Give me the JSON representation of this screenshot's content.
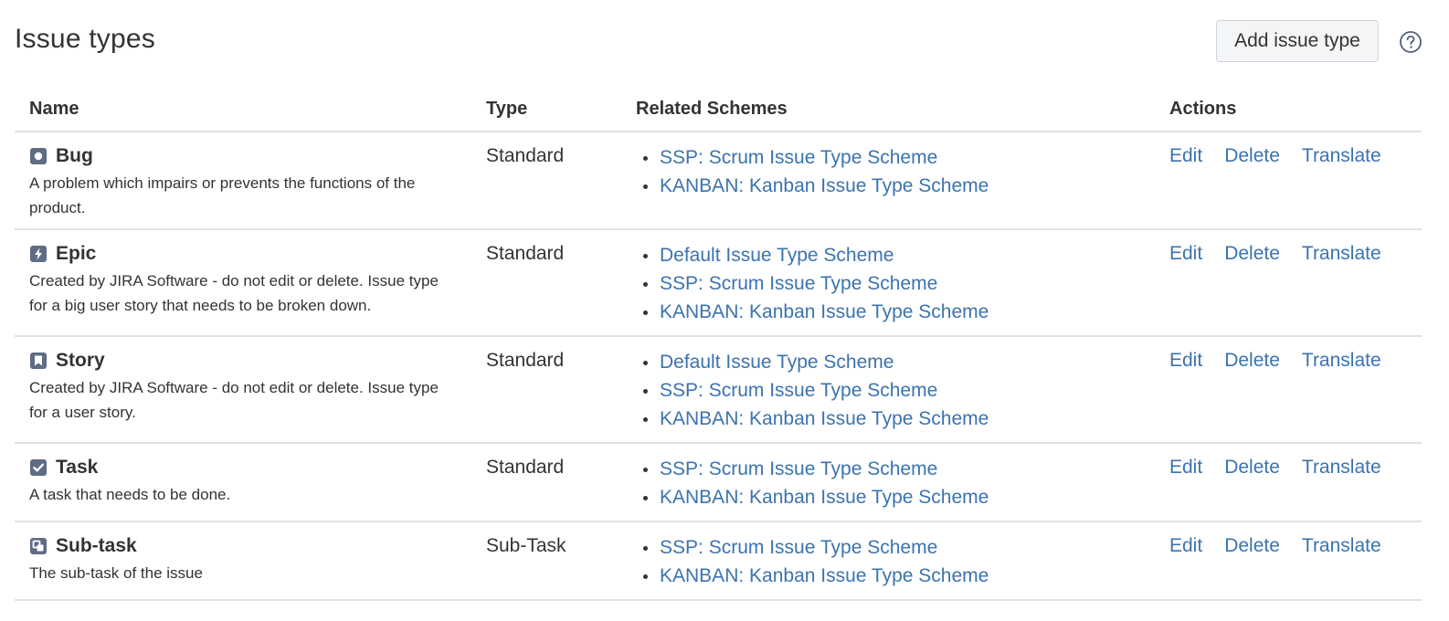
{
  "page": {
    "title": "Issue types",
    "add_button_label": "Add issue type",
    "help_icon": "question-circle-icon"
  },
  "table": {
    "headers": {
      "name": "Name",
      "type": "Type",
      "schemes": "Related Schemes",
      "actions": "Actions"
    },
    "action_labels": {
      "edit": "Edit",
      "delete": "Delete",
      "translate": "Translate"
    },
    "rows": [
      {
        "icon": "bug-icon",
        "icon_color": "#5e6c84",
        "name": "Bug",
        "description": "A problem which impairs or prevents the functions of the product.",
        "type": "Standard",
        "schemes": [
          "SSP: Scrum Issue Type Scheme",
          "KANBAN: Kanban Issue Type Scheme"
        ]
      },
      {
        "icon": "epic-icon",
        "icon_color": "#5e6c84",
        "name": "Epic",
        "description": "Created by JIRA Software - do not edit or delete. Issue type for a big user story that needs to be broken down.",
        "type": "Standard",
        "schemes": [
          "Default Issue Type Scheme",
          "SSP: Scrum Issue Type Scheme",
          "KANBAN: Kanban Issue Type Scheme"
        ]
      },
      {
        "icon": "story-icon",
        "icon_color": "#5e6c84",
        "name": "Story",
        "description": "Created by JIRA Software - do not edit or delete. Issue type for a user story.",
        "type": "Standard",
        "schemes": [
          "Default Issue Type Scheme",
          "SSP: Scrum Issue Type Scheme",
          "KANBAN: Kanban Issue Type Scheme"
        ]
      },
      {
        "icon": "task-icon",
        "icon_color": "#5e6c84",
        "name": "Task",
        "description": "A task that needs to be done.",
        "type": "Standard",
        "schemes": [
          "SSP: Scrum Issue Type Scheme",
          "KANBAN: Kanban Issue Type Scheme"
        ]
      },
      {
        "icon": "subtask-icon",
        "icon_color": "#5e6c84",
        "name": "Sub-task",
        "description": "The sub-task of the issue",
        "type": "Sub-Task",
        "schemes": [
          "SSP: Scrum Issue Type Scheme",
          "KANBAN: Kanban Issue Type Scheme"
        ]
      }
    ]
  },
  "colors": {
    "link": "#3b73af",
    "text": "#333333",
    "border": "#dfe1e6",
    "icon": "#5e6c84"
  }
}
